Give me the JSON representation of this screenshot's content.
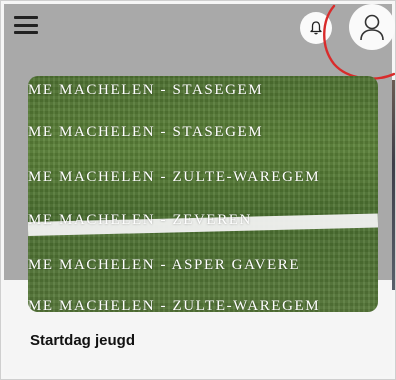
{
  "header": {
    "menu_icon": "hamburger-menu-icon",
    "notification_icon": "bell-icon",
    "profile_icon": "user-icon",
    "annotation_color": "#d92b2b"
  },
  "card": {
    "title": "Startdag jeugd",
    "banner_lines": [
      "ME MACHELEN -  STASEGEM",
      "ME MACHELEN -  STASEGEM",
      "ME MACHELEN - ZULTE-WAREGEM",
      "ME MACHELEN - ZEVEREN",
      "ME MACHELEN - ASPER GAVERE",
      "ME MACHELEN - ZULTE-WAREGEM"
    ]
  }
}
